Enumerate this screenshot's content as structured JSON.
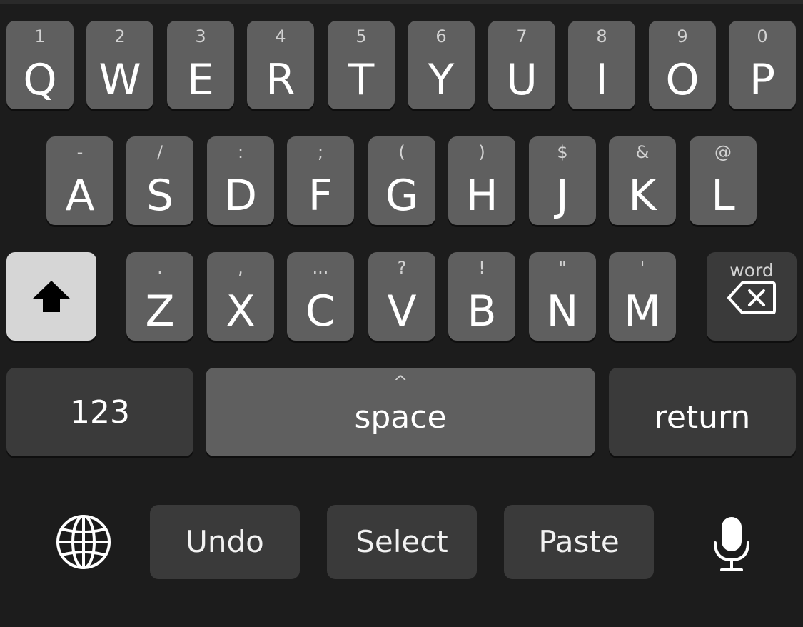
{
  "keyboard": {
    "row1": [
      {
        "hint": "1",
        "letter": "Q"
      },
      {
        "hint": "2",
        "letter": "W"
      },
      {
        "hint": "3",
        "letter": "E"
      },
      {
        "hint": "4",
        "letter": "R"
      },
      {
        "hint": "5",
        "letter": "T"
      },
      {
        "hint": "6",
        "letter": "Y"
      },
      {
        "hint": "7",
        "letter": "U"
      },
      {
        "hint": "8",
        "letter": "I"
      },
      {
        "hint": "9",
        "letter": "O"
      },
      {
        "hint": "0",
        "letter": "P"
      }
    ],
    "row2": [
      {
        "hint": "-",
        "letter": "A"
      },
      {
        "hint": "/",
        "letter": "S"
      },
      {
        "hint": ":",
        "letter": "D"
      },
      {
        "hint": ";",
        "letter": "F"
      },
      {
        "hint": "(",
        "letter": "G"
      },
      {
        "hint": ")",
        "letter": "H"
      },
      {
        "hint": "$",
        "letter": "J"
      },
      {
        "hint": "&",
        "letter": "K"
      },
      {
        "hint": "@",
        "letter": "L"
      }
    ],
    "row3": [
      {
        "hint": ".",
        "letter": "Z"
      },
      {
        "hint": ",",
        "letter": "X"
      },
      {
        "hint": "...",
        "letter": "C"
      },
      {
        "hint": "?",
        "letter": "V"
      },
      {
        "hint": "!",
        "letter": "B"
      },
      {
        "hint": "\"",
        "letter": "N"
      },
      {
        "hint": "'",
        "letter": "M"
      }
    ],
    "shift_icon": "shift-arrow-icon",
    "delete": {
      "hint": "word",
      "icon": "delete-backward-icon"
    },
    "numbers_label": "123",
    "space": {
      "hint": "^",
      "label": "space"
    },
    "return_label": "return"
  },
  "toolbar": {
    "globe_icon": "globe-icon",
    "undo_label": "Undo",
    "select_label": "Select",
    "paste_label": "Paste",
    "mic_icon": "microphone-icon"
  },
  "colors": {
    "background": "#1c1c1c",
    "letter_key": "#5f5f5f",
    "function_key": "#3a3a3a",
    "shift_active": "#d6d6d6"
  }
}
